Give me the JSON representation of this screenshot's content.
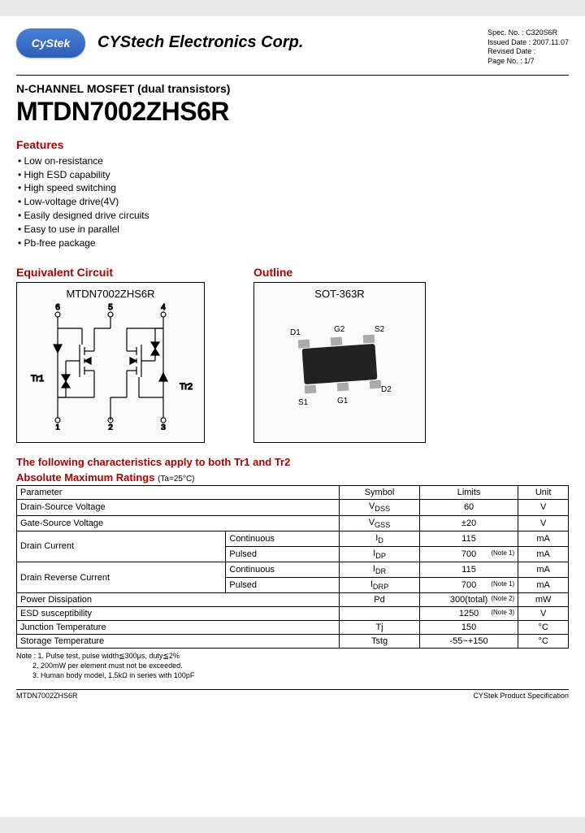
{
  "header": {
    "logo_text": "CyStek",
    "company": "CYStech Electronics Corp.",
    "spec_no_label": "Spec. No. :",
    "spec_no": "C320S6R",
    "issued_label": "Issued Date :",
    "issued_date": "2007.11.07",
    "revised_label": "Revised Date :",
    "revised_date": "",
    "page_label": "Page No. :",
    "page_no": "1/7"
  },
  "title": {
    "subtitle": "N-CHANNEL MOSFET (dual transistors)",
    "part_number": "MTDN7002ZHS6R"
  },
  "features": {
    "heading": "Features",
    "items": [
      "Low on-resistance",
      "High ESD capability",
      "High speed switching",
      "Low-voltage drive(4V)",
      "Easily designed drive circuits",
      "Easy to use in parallel",
      "Pb-free package"
    ]
  },
  "equiv_circuit": {
    "heading": "Equivalent Circuit",
    "label": "MTDN7002ZHS6R",
    "tr1": "Tr1",
    "tr2": "Tr2",
    "pins_top": [
      "6",
      "5",
      "4"
    ],
    "pins_bot": [
      "1",
      "2",
      "3"
    ]
  },
  "outline": {
    "heading": "Outline",
    "label": "SOT-363R",
    "pins": {
      "D1": "D1",
      "G2": "G2",
      "S2": "S2",
      "S1": "S1",
      "G1": "G1",
      "D2": "D2"
    }
  },
  "characteristics_note": "The following characteristics apply to both Tr1 and Tr2",
  "ratings": {
    "heading": "Absolute Maximum Ratings",
    "condition": "(Ta=25°C)",
    "headers": {
      "param": "Parameter",
      "symbol": "Symbol",
      "limits": "Limits",
      "unit": "Unit"
    },
    "rows": [
      {
        "param": "Drain-Source Voltage",
        "sub": "",
        "symbol": "V",
        "sub_sym": "DSS",
        "limits": "60",
        "note": "",
        "unit": "V"
      },
      {
        "param": "Gate-Source Voltage",
        "sub": "",
        "symbol": "V",
        "sub_sym": "GSS",
        "limits": "±20",
        "note": "",
        "unit": "V"
      },
      {
        "param": "Drain Current",
        "sub": "Continuous",
        "symbol": "I",
        "sub_sym": "D",
        "limits": "115",
        "note": "",
        "unit": "mA",
        "rowspan": 2
      },
      {
        "param": "",
        "sub": "Pulsed",
        "symbol": "I",
        "sub_sym": "DP",
        "limits": "700",
        "note": "(Note 1)",
        "unit": "mA"
      },
      {
        "param": "Drain Reverse Current",
        "sub": "Continuous",
        "symbol": "I",
        "sub_sym": "DR",
        "limits": "115",
        "note": "",
        "unit": "mA",
        "rowspan": 2
      },
      {
        "param": "",
        "sub": "Pulsed",
        "symbol": "I",
        "sub_sym": "DRP",
        "limits": "700",
        "note": "(Note 1)",
        "unit": "mA"
      },
      {
        "param": "Power Dissipation",
        "sub": "",
        "symbol": "Pd",
        "sub_sym": "",
        "limits": "300(total)",
        "note": "(Note 2)",
        "unit": "mW"
      },
      {
        "param": "ESD susceptibility",
        "sub": "",
        "symbol": "",
        "sub_sym": "",
        "limits": "1250",
        "note": "(Note 3)",
        "unit": "V"
      },
      {
        "param": "Junction Temperature",
        "sub": "",
        "symbol": "Tj",
        "sub_sym": "",
        "limits": "150",
        "note": "",
        "unit": "°C"
      },
      {
        "param": "Storage Temperature",
        "sub": "",
        "symbol": "Tstg",
        "sub_sym": "",
        "limits": "-55~+150",
        "note": "",
        "unit": "°C"
      }
    ]
  },
  "notes": {
    "prefix": "Note :",
    "lines": [
      "1. Pulse test, pulse width≦300μs, duty≦2%",
      "2. 200mW per element must not be exceeded.",
      "3. Human body model, 1.5kΩ in series with 100pF"
    ]
  },
  "footer": {
    "left": "MTDN7002ZHS6R",
    "right": "CYStek Product Specification"
  }
}
